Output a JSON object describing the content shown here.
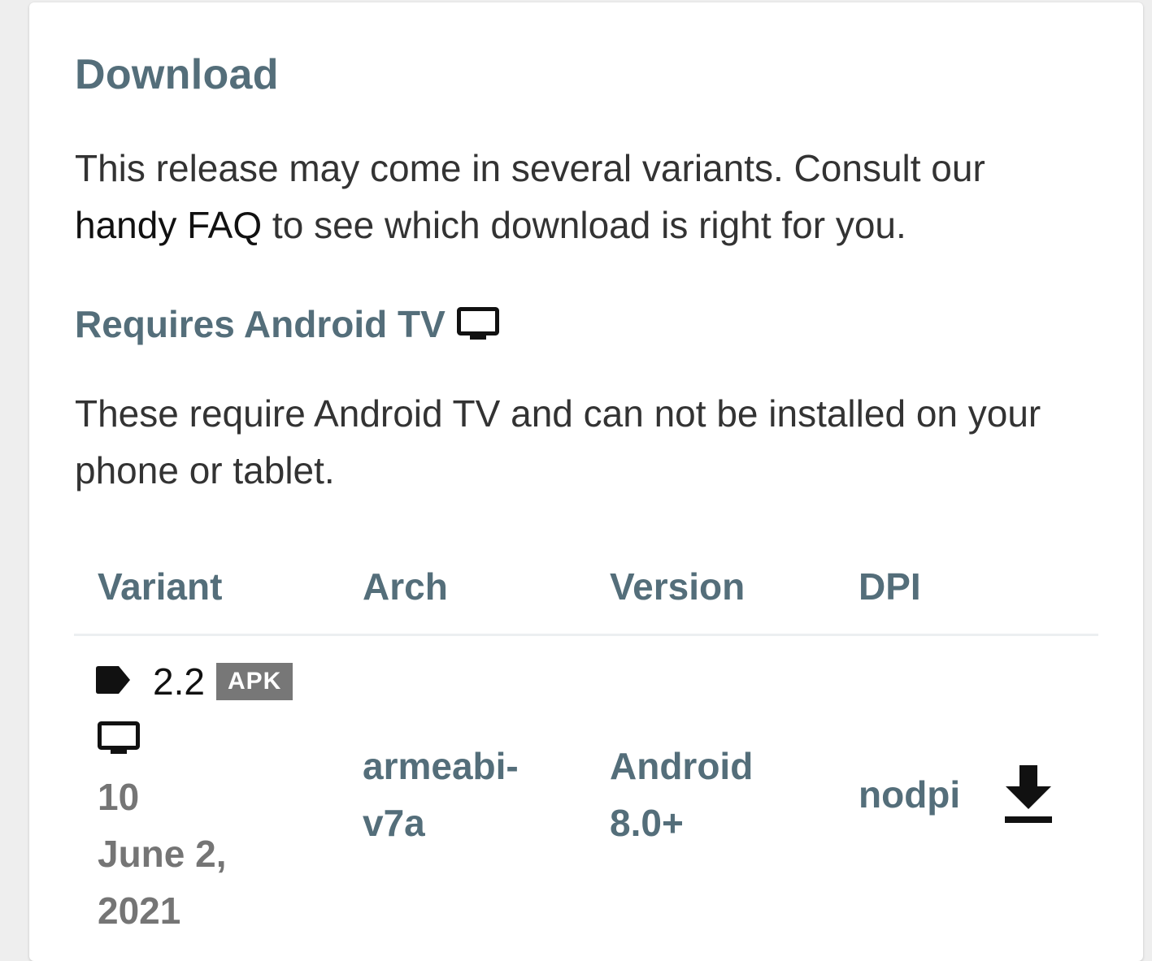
{
  "card": {
    "title": "Download",
    "intro": {
      "before": "This release may come in several variants. Consult our ",
      "link": "handy FAQ",
      "after": " to see which download is right for you."
    },
    "requirement": {
      "heading": "Requires Android TV",
      "icon": "tv-icon",
      "note": "These require Android TV and can not be installed on your phone or tablet."
    },
    "table": {
      "headers": [
        "Variant",
        "Arch",
        "Version",
        "DPI"
      ],
      "rows": [
        {
          "variant_name": "2.2",
          "badge": "APK",
          "tag_icon": "tag-icon",
          "device_icon": "tv-icon",
          "variant_code": "10",
          "date": "June 2, 2021",
          "arch": "armeabi-v7a",
          "version": "Android 8.0+",
          "dpi": "nodpi",
          "download_icon": "download-icon"
        }
      ]
    }
  }
}
